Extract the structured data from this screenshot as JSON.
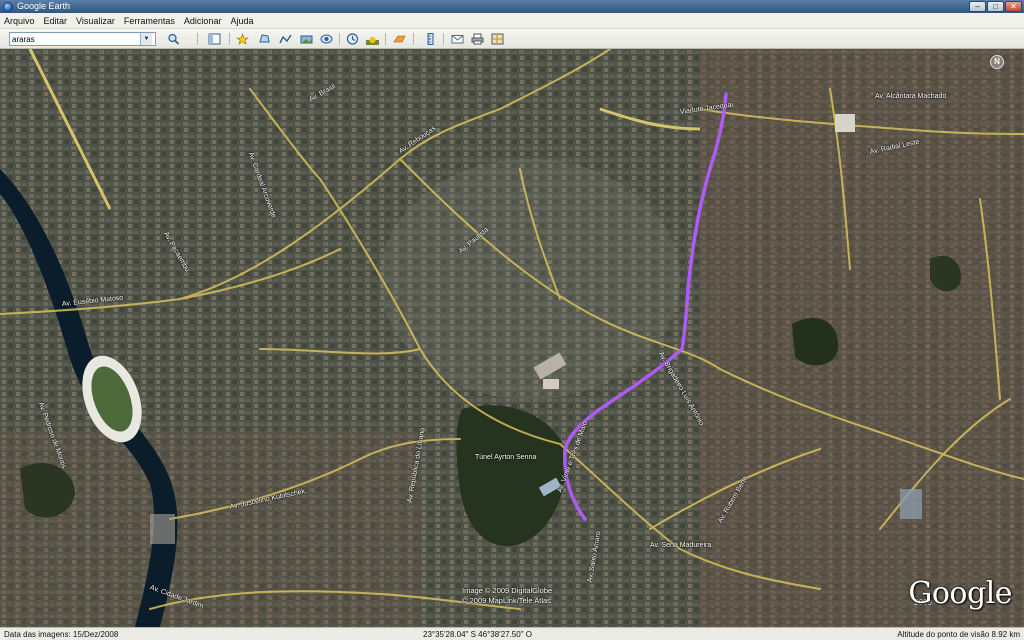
{
  "window": {
    "title": "Google Earth",
    "controls": {
      "minimize": "–",
      "maximize": "□",
      "close": "✕"
    }
  },
  "menu": {
    "items": [
      "Arquivo",
      "Editar",
      "Visualizar",
      "Ferramentas",
      "Adicionar",
      "Ajuda"
    ]
  },
  "toolbar": {
    "search_value": "araras",
    "dropdown_arrow": "▼",
    "icons": [
      "search-icon",
      "sidebar-toggle-icon",
      "placemark-icon",
      "polygon-icon",
      "path-icon",
      "image-overlay-icon",
      "record-tour-icon",
      "historical-imagery-icon",
      "sunlight-icon",
      "planet-switch-icon",
      "ruler-icon",
      "email-icon",
      "print-icon",
      "maps-view-icon"
    ]
  },
  "map": {
    "compass_letter": "N",
    "road_labels": [
      "Av. Alcântara Machado",
      "Viaduto Jacequai",
      "Av. Eusébio Matoso",
      "Av. Brasil",
      "Av. Rebouças",
      "Av. Paulista",
      "Av. Radial Leste",
      "Túnel Ayrton Senna",
      "Av. República do Líbano",
      "Av. Juscelino Kubitschek",
      "Av. Sena Madureira",
      "Av. Vinte e Três de Maio",
      "Av. Rubem Berta",
      "Av. Cidade Jardim",
      "Av. Santo Amaro",
      "Av. Brigadeiro Luís Antônio",
      "Av. Pedroso de Morais",
      "Av. Pacaembu",
      "Av. Cardeal Arcoverde"
    ],
    "copyright_lines": [
      "Image © 2009 DigitalGlobe",
      "© 2009 MapLink/Tele Atlas"
    ],
    "year": "2009",
    "logo_text": "Google",
    "colors": {
      "route": "#b35cff",
      "road": "#d8c25a",
      "river": "#0b1c2a",
      "park": "#26331f"
    }
  },
  "status": {
    "imagery_date": "Data das imagens: 15/Dez/2008",
    "coordinates": "23°35'28.04\" S   46°38'27.50\" O",
    "eye_altitude": "Altitude do ponto de visão   8.92 km"
  }
}
